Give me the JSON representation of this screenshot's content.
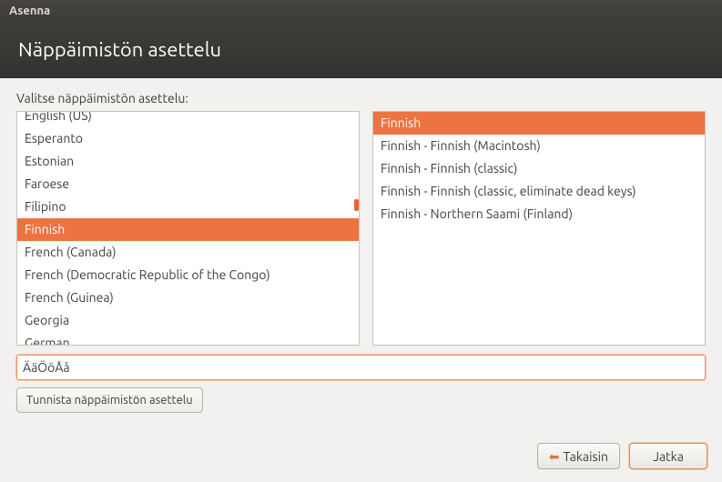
{
  "window": {
    "title": "Asenna"
  },
  "header": {
    "title": "Näppäimistön asettelu"
  },
  "prompt": "Valitse näppäimistön asettelu:",
  "layouts": {
    "cutoff_first": "",
    "items": [
      "English (US)",
      "Esperanto",
      "Estonian",
      "Faroese",
      "Filipino",
      "Finnish",
      "French (Canada)",
      "French (Democratic Republic of the Congo)",
      "French (Guinea)",
      "Georgia",
      "German"
    ],
    "selected_index": 5
  },
  "variants": {
    "items": [
      "Finnish",
      "Finnish - Finnish (Macintosh)",
      "Finnish - Finnish (classic)",
      "Finnish - Finnish (classic, eliminate dead keys)",
      "Finnish - Northern Saami (Finland)"
    ],
    "selected_index": 0
  },
  "test_input": {
    "value": "ÄäÖöÅå"
  },
  "buttons": {
    "detect": "Tunnista näppäimistön asettelu",
    "back": "Takaisin",
    "continue": "Jatka"
  }
}
